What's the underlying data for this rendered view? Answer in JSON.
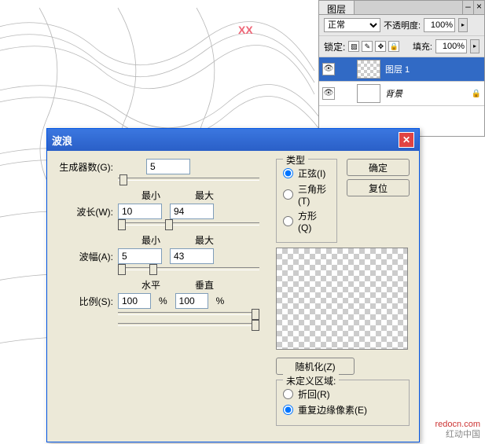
{
  "watermark": "XX",
  "layersPanel": {
    "tab": "图层",
    "minIcon": "–",
    "closeIcon": "×",
    "blendMode": "正常",
    "opacityLabel": "不透明度:",
    "opacityValue": "100%",
    "lockLabel": "锁定:",
    "fillLabel": "填充:",
    "fillValue": "100%",
    "lockIcons": [
      "▨",
      "✎",
      "✥",
      "🔒"
    ],
    "layers": [
      {
        "name": "图层 1",
        "selected": true,
        "checker": true,
        "locked": false
      },
      {
        "name": "背景",
        "selected": false,
        "checker": false,
        "locked": true
      }
    ]
  },
  "dialog": {
    "title": "波浪",
    "generators": {
      "label": "生成器数(G):",
      "value": "5"
    },
    "minLabel": "最小",
    "maxLabel": "最大",
    "wavelength": {
      "label": "波长(W):",
      "min": "10",
      "max": "94"
    },
    "amplitude": {
      "label": "波幅(A):",
      "min": "5",
      "max": "43"
    },
    "scaleHorizLabel": "水平",
    "scaleVertLabel": "垂直",
    "scale": {
      "label": "比例(S):",
      "horiz": "100",
      "vert": "100",
      "pct": "%"
    },
    "typeGroup": {
      "title": "类型",
      "sine": "正弦(I)",
      "triangle": "三角形 (T)",
      "square": "方形(Q)"
    },
    "okBtn": "确定",
    "resetBtn": "复位",
    "randomBtn": "随机化(Z)",
    "undefGroup": {
      "title": "未定义区域:",
      "wrap": "折回(R)",
      "repeat": "重复边缘像素(E)"
    }
  },
  "footer": {
    "line1": "redocn.com",
    "line2": "红动中国"
  }
}
